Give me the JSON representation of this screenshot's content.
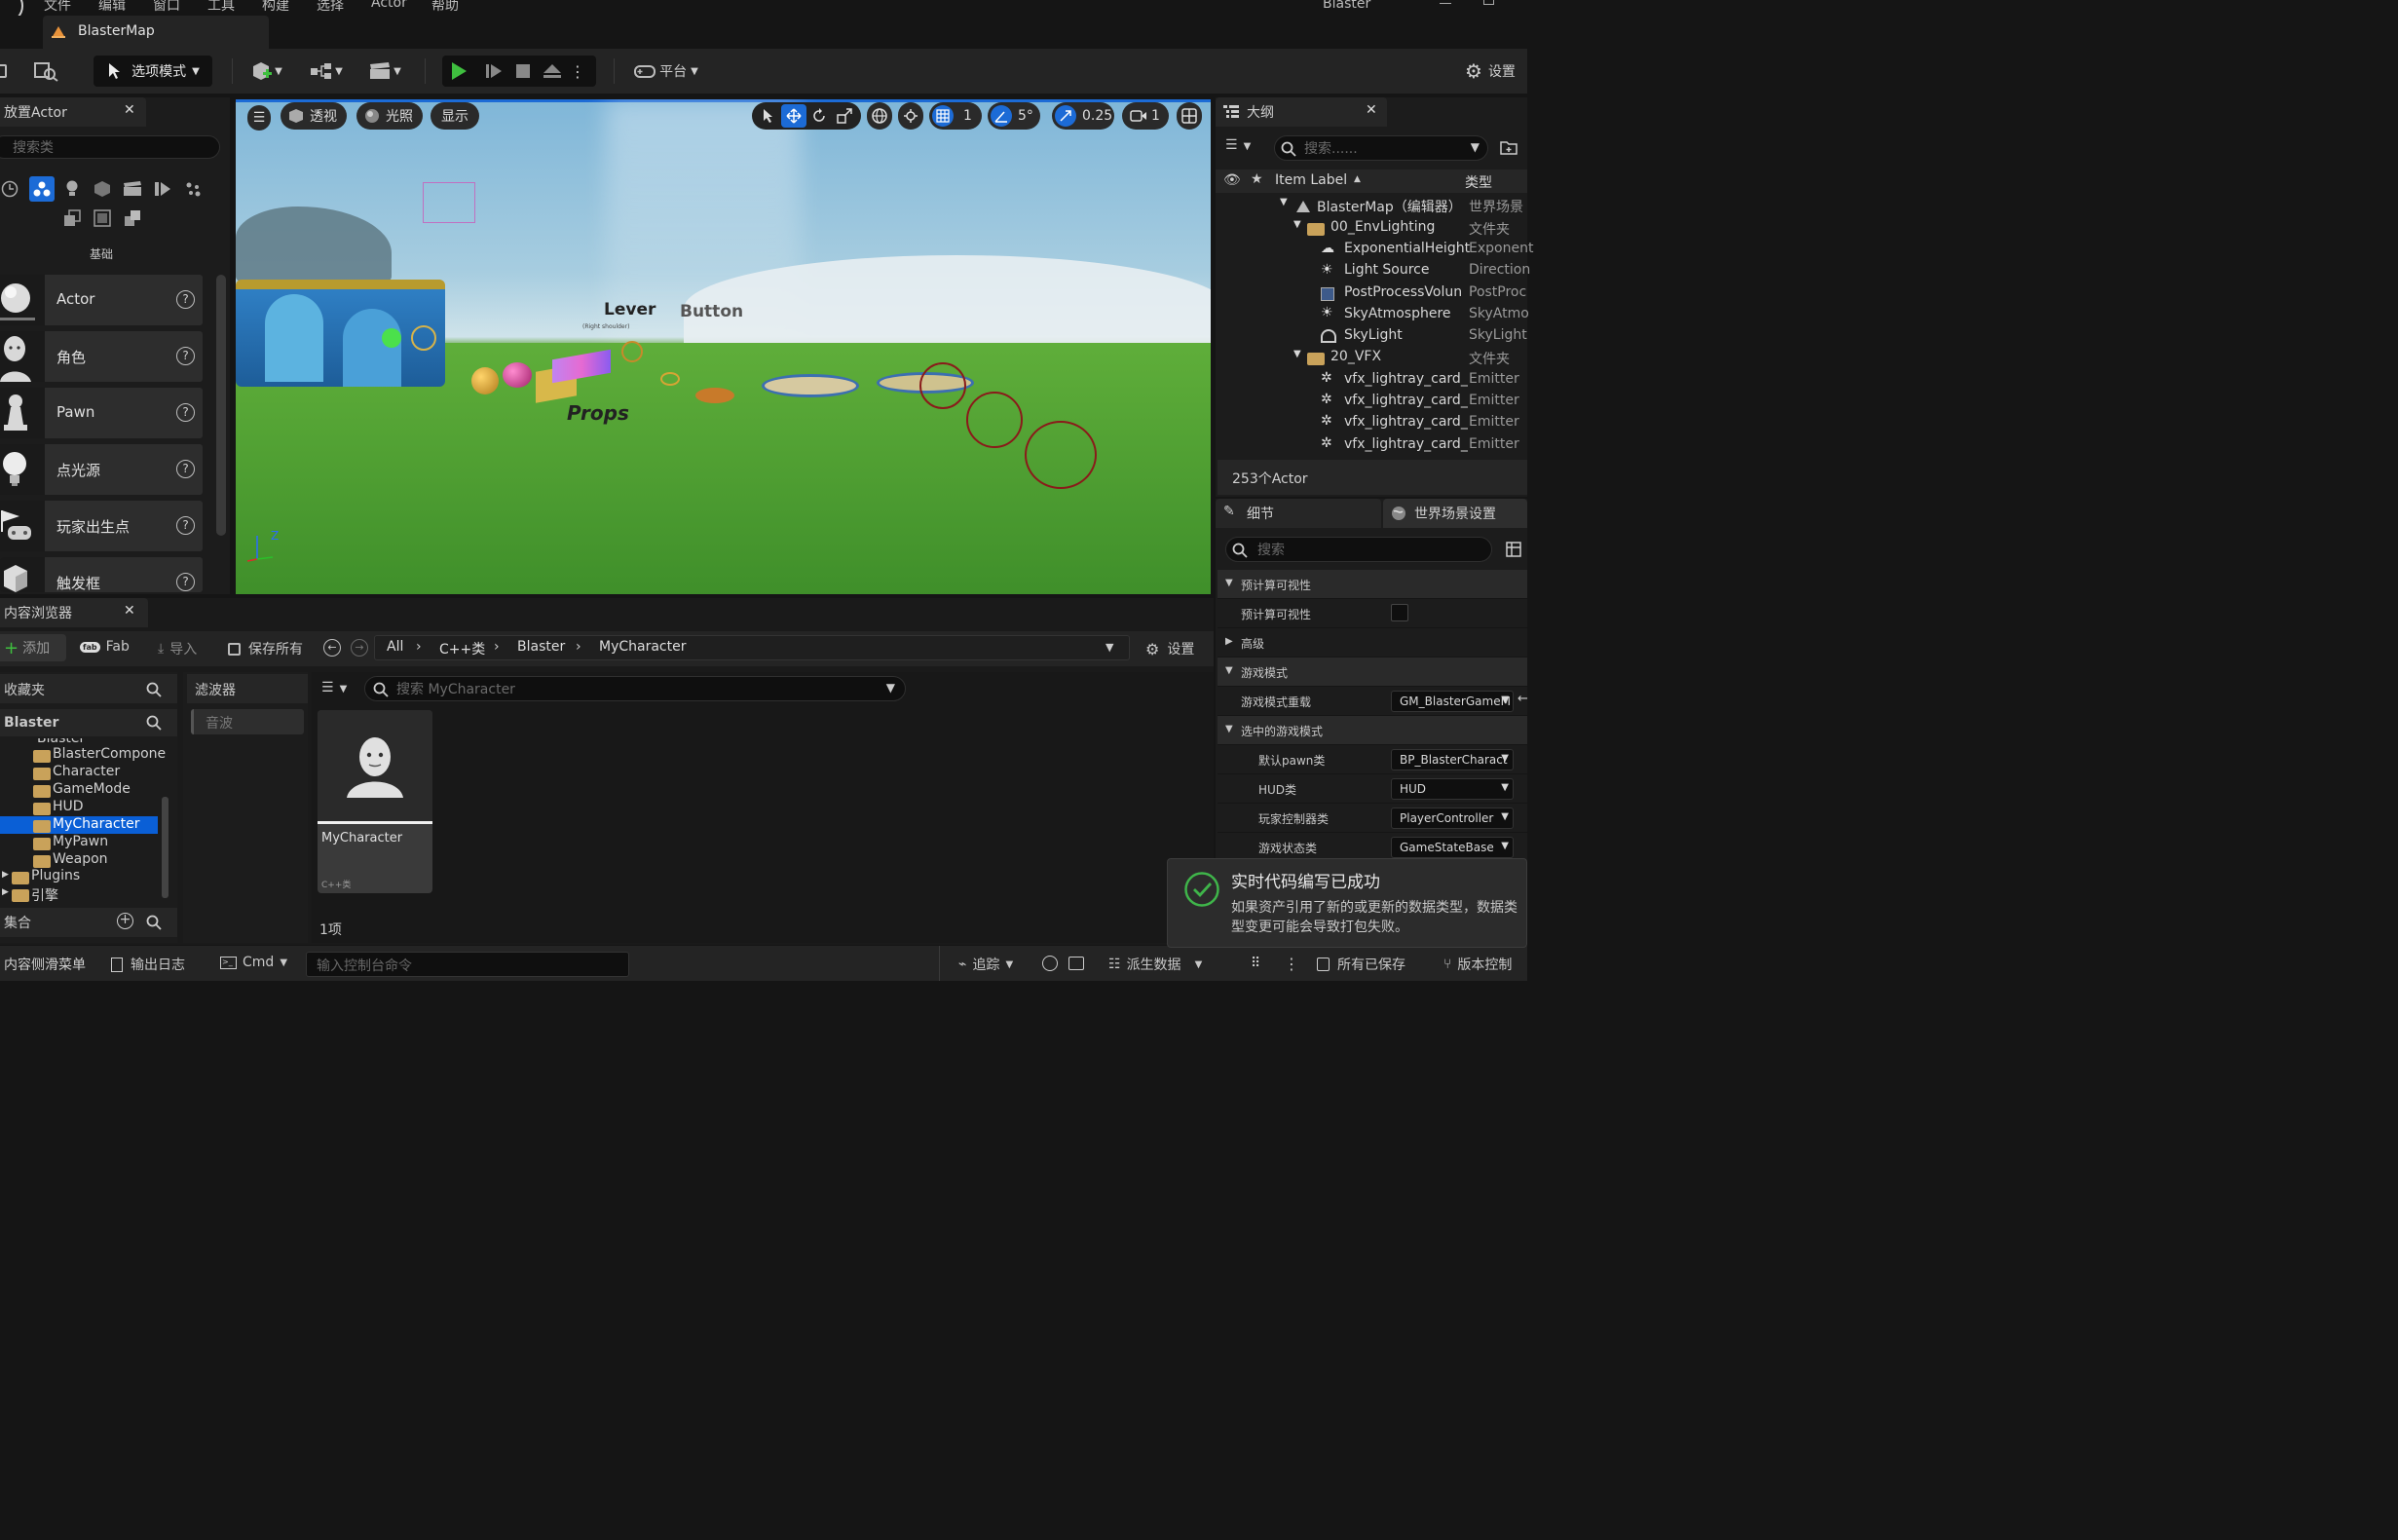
{
  "menu": {
    "items": [
      "文件",
      "编辑",
      "窗口",
      "工具",
      "构建",
      "选择",
      "Actor",
      "帮助"
    ],
    "project": "Blaster"
  },
  "level_tab": {
    "label": "BlasterMap"
  },
  "toolbar": {
    "mode_label": "选项模式",
    "platform_label": "平台",
    "settings_label": "设置"
  },
  "place_actors": {
    "title": "放置Actor",
    "search_placeholder": "搜索类",
    "category_label": "基础",
    "items": [
      {
        "label": "Actor"
      },
      {
        "label": "角色"
      },
      {
        "label": "Pawn"
      },
      {
        "label": "点光源"
      },
      {
        "label": "玩家出生点"
      },
      {
        "label": "触发框"
      }
    ]
  },
  "viewport": {
    "perspective_label": "透视",
    "lighting_label": "光照",
    "show_label": "显示",
    "grid_value": "1",
    "angle_value": "5°",
    "scale_value": "0.25",
    "camera_speed": "1",
    "scene_text": {
      "lever": "Lever",
      "button": "Button",
      "props": "Props",
      "lever_sub": "(Right shoulder)"
    }
  },
  "outliner": {
    "title": "大纲",
    "search_placeholder": "搜索......",
    "col_label": "Item Label",
    "col_type": "类型",
    "rows": [
      {
        "label": "BlasterMap（编辑器）",
        "type": "世界场景"
      },
      {
        "label": "00_EnvLighting",
        "type": "文件夹"
      },
      {
        "label": "ExponentialHeight",
        "type": "Exponent"
      },
      {
        "label": "Light Source",
        "type": "Direction"
      },
      {
        "label": "PostProcessVolun",
        "type": "PostProc"
      },
      {
        "label": "SkyAtmosphere",
        "type": "SkyAtmo"
      },
      {
        "label": "SkyLight",
        "type": "SkyLight"
      },
      {
        "label": "20_VFX",
        "type": "文件夹"
      },
      {
        "label": "vfx_lightray_card_",
        "type": "Emitter"
      },
      {
        "label": "vfx_lightray_card_",
        "type": "Emitter"
      },
      {
        "label": "vfx_lightray_card_",
        "type": "Emitter"
      },
      {
        "label": "vfx_lightray_card_",
        "type": "Emitter"
      }
    ],
    "count_label": "253个Actor"
  },
  "details": {
    "tab_details": "细节",
    "tab_world": "世界场景设置",
    "search_placeholder": "搜索",
    "rows": {
      "sec_precomputed": "预计算可视性",
      "precomputed": "预计算可视性",
      "advanced": "高级",
      "sec_gamemode": "游戏模式",
      "gamemode_override": "游戏模式重载",
      "gamemode_override_value": "GM_BlasterGameM",
      "sec_selected": "选中的游戏模式",
      "default_pawn": "默认pawn类",
      "default_pawn_value": "BP_BlasterCharact",
      "hud": "HUD类",
      "hud_value": "HUD",
      "player_controller": "玩家控制器类",
      "player_controller_value": "PlayerController",
      "game_state": "游戏状态类",
      "game_state_value": "GameStateBase"
    }
  },
  "content_browser": {
    "title": "内容浏览器",
    "add_label": "添加",
    "fab_label": "Fab",
    "import_label": "导入",
    "save_all_label": "保存所有",
    "breadcrumb": [
      "All",
      "C++类",
      "Blaster",
      "MyCharacter"
    ],
    "settings_label": "设置",
    "favorites_label": "收藏夹",
    "root_label": "Blaster",
    "tree_partial": "Blaster",
    "tree": [
      "BlasterCompone",
      "Character",
      "GameMode",
      "HUD",
      "MyCharacter",
      "MyPawn",
      "Weapon"
    ],
    "plugins_label": "Plugins",
    "engine_label": "引擎",
    "collections_label": "集合",
    "filters_label": "滤波器",
    "filter_chip": "音波",
    "search_placeholder": "搜索 MyCharacter",
    "asset": {
      "name": "MyCharacter",
      "type": "C++类"
    },
    "item_count": "1项"
  },
  "statusbar": {
    "drawer": "内容侧滑菜单",
    "output_log": "输出日志",
    "cmd": "Cmd",
    "console_placeholder": "输入控制台命令",
    "trace": "追踪",
    "derived_data": "派生数据",
    "all_saved": "所有已保存",
    "version_control": "版本控制"
  },
  "toast": {
    "title": "实时代码编写已成功",
    "body": "如果资产引用了新的或更新的数据类型，数据类型变更可能会导致打包失败。"
  },
  "colors": {
    "accent": "#1c6bd6",
    "play_green": "#3fbf3f",
    "success": "#3fb54a",
    "selection": "#0a5fd6"
  }
}
